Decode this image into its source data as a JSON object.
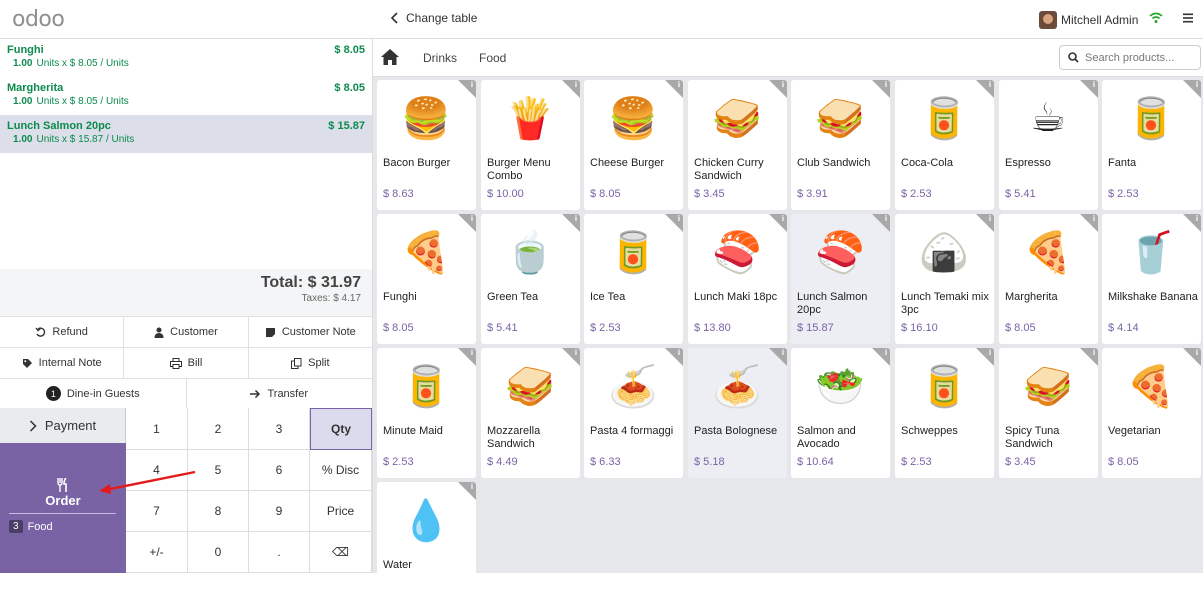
{
  "header": {
    "logo": "odoo",
    "back_label": "Change table",
    "user_name": "Mitchell Admin"
  },
  "order": {
    "lines": [
      {
        "name": "Funghi",
        "price": "$ 8.05",
        "qty": "1.00",
        "detail": "Units x $ 8.05 / Units",
        "selected": false
      },
      {
        "name": "Margherita",
        "price": "$ 8.05",
        "qty": "1.00",
        "detail": "Units x $ 8.05 / Units",
        "selected": false
      },
      {
        "name": "Lunch Salmon 20pc",
        "price": "$ 15.87",
        "qty": "1.00",
        "detail": "Units x $ 15.87 / Units",
        "selected": true
      }
    ],
    "total": "Total: $ 31.97",
    "taxes": "Taxes: $ 4.17"
  },
  "controls": {
    "refund": "Refund",
    "customer": "Customer",
    "customer_note": "Customer Note",
    "internal_note": "Internal Note",
    "bill": "Bill",
    "split": "Split",
    "guests_count": "1",
    "guests": "Dine-in Guests",
    "transfer": "Transfer"
  },
  "pad": {
    "payment": "Payment",
    "order": "Order",
    "order_count": "3",
    "order_category": "Food",
    "keys": [
      "1",
      "2",
      "3",
      "Qty",
      "4",
      "5",
      "6",
      "% Disc",
      "7",
      "8",
      "9",
      "Price",
      "+/-",
      "0",
      ".",
      "⌫"
    ],
    "active_key": "Qty"
  },
  "categories": {
    "items": [
      "Drinks",
      "Food"
    ],
    "search_placeholder": "Search products..."
  },
  "products": [
    {
      "name": "Bacon Burger",
      "price": "$ 8.63",
      "icon": "🍔"
    },
    {
      "name": "Burger Menu Combo",
      "price": "$ 10.00",
      "icon": "🍟"
    },
    {
      "name": "Cheese Burger",
      "price": "$ 8.05",
      "icon": "🍔"
    },
    {
      "name": "Chicken Curry Sandwich",
      "price": "$ 3.45",
      "icon": "🥪"
    },
    {
      "name": "Club Sandwich",
      "price": "$ 3.91",
      "icon": "🥪"
    },
    {
      "name": "Coca-Cola",
      "price": "$ 2.53",
      "icon": "🥫"
    },
    {
      "name": "Espresso",
      "price": "$ 5.41",
      "icon": "☕"
    },
    {
      "name": "Fanta",
      "price": "$ 2.53",
      "icon": "🥫"
    },
    {
      "name": "Funghi",
      "price": "$ 8.05",
      "icon": "🍕"
    },
    {
      "name": "Green Tea",
      "price": "$ 5.41",
      "icon": "🍵"
    },
    {
      "name": "Ice Tea",
      "price": "$ 2.53",
      "icon": "🥫"
    },
    {
      "name": "Lunch Maki 18pc",
      "price": "$ 13.80",
      "icon": "🍣"
    },
    {
      "name": "Lunch Salmon 20pc",
      "price": "$ 15.87",
      "icon": "🍣",
      "highlight": true
    },
    {
      "name": "Lunch Temaki mix 3pc",
      "price": "$ 16.10",
      "icon": "🍙"
    },
    {
      "name": "Margherita",
      "price": "$ 8.05",
      "icon": "🍕"
    },
    {
      "name": "Milkshake Banana",
      "price": "$ 4.14",
      "icon": "🥤"
    },
    {
      "name": "Minute Maid",
      "price": "$ 2.53",
      "icon": "🥫"
    },
    {
      "name": "Mozzarella Sandwich",
      "price": "$ 4.49",
      "icon": "🥪"
    },
    {
      "name": "Pasta 4 formaggi",
      "price": "$ 6.33",
      "icon": "🍝"
    },
    {
      "name": "Pasta Bolognese",
      "price": "$ 5.18",
      "icon": "🍝",
      "highlight": true
    },
    {
      "name": "Salmon and Avocado",
      "price": "$ 10.64",
      "icon": "🥗"
    },
    {
      "name": "Schweppes",
      "price": "$ 2.53",
      "icon": "🥫"
    },
    {
      "name": "Spicy Tuna Sandwich",
      "price": "$ 3.45",
      "icon": "🥪"
    },
    {
      "name": "Vegetarian",
      "price": "$ 8.05",
      "icon": "🍕"
    },
    {
      "name": "Water",
      "price": "",
      "icon": "💧"
    }
  ],
  "colors": {
    "accent": "#7a63a5",
    "line_green": "#0c8a4e",
    "wifi": "#22a62a"
  }
}
